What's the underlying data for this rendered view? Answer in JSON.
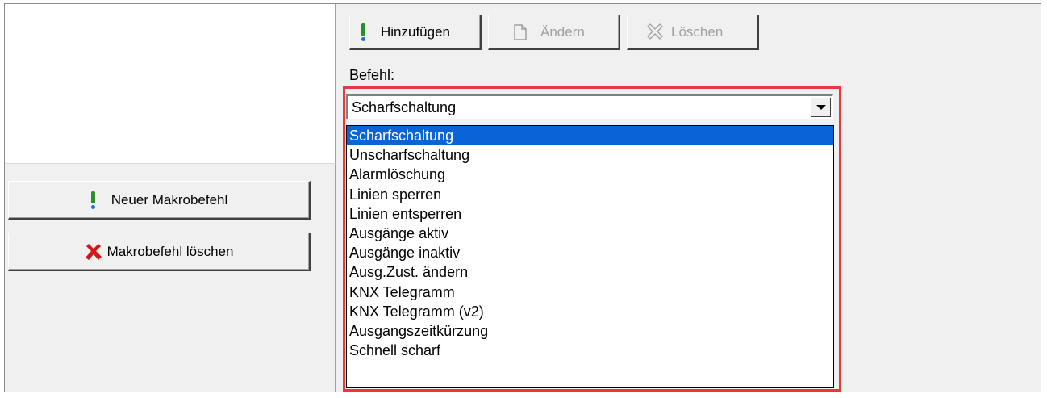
{
  "toolbar": {
    "add_label": "Hinzufügen",
    "edit_label": "Ändern",
    "delete_label": "Löschen"
  },
  "command": {
    "label": "Befehl:",
    "selected": "Scharfschaltung",
    "options": [
      "Scharfschaltung",
      "Unscharfschaltung",
      "Alarmlöschung",
      "Linien sperren",
      "Linien entsperren",
      "Ausgänge aktiv",
      "Ausgänge inaktiv",
      "Ausg.Zust. ändern",
      "KNX Telegramm",
      "KNX Telegramm (v2)",
      "Ausgangszeitkürzung",
      "Schnell scharf"
    ]
  },
  "macro": {
    "new_label": "Neuer Makrobefehl",
    "delete_label": "Makrobefehl löschen"
  },
  "colors": {
    "highlight": "#0a64d8",
    "red_outline": "#e8383d",
    "excl_green": "#2a8f2a",
    "delete_red": "#d01818"
  },
  "icons": {
    "add": "exclamation-icon",
    "edit": "document-icon",
    "delete": "x-outline-icon",
    "new_macro": "exclamation-icon",
    "delete_macro": "red-x-icon"
  }
}
